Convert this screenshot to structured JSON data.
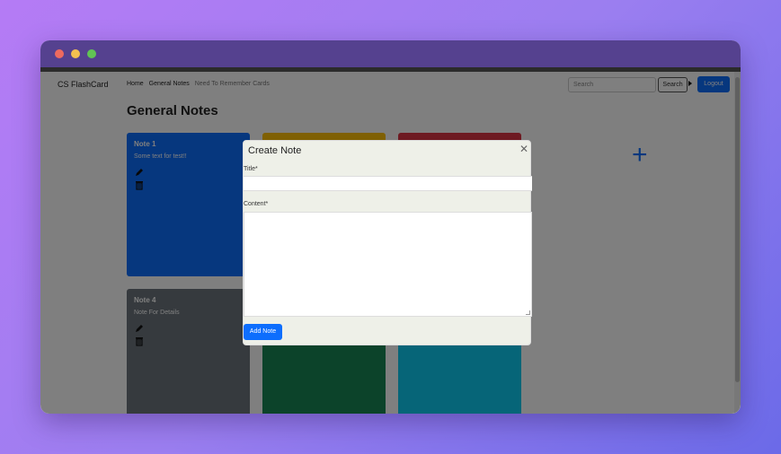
{
  "navbar": {
    "brand": "CS FlashCard",
    "links": [
      "Home",
      "General Notes",
      "Need To Remember Cards"
    ],
    "search_placeholder": "Search",
    "search_label": "Search",
    "logout_label": "Logout"
  },
  "main": {
    "heading": "General Notes",
    "add_symbol": "+",
    "cards": [
      {
        "title": "Note 1",
        "text": "Some text for test!!"
      },
      {
        "title": "",
        "text": ""
      },
      {
        "title": "",
        "text": ""
      },
      {
        "title": "Note 4",
        "text": "Note For Details"
      },
      {
        "title": "",
        "text": ""
      },
      {
        "title": "",
        "text": ""
      }
    ]
  },
  "modal": {
    "title": "Create Note",
    "close": "✕",
    "title_label": "Title*",
    "content_label": "Content*",
    "submit_label": "Add Note"
  },
  "colors": {
    "primary": "#0d6efd",
    "card_colors": [
      "#0d6efd",
      "#ffc107",
      "#dc3545",
      "#6c757d",
      "#198754",
      "#0dcaf0"
    ]
  },
  "icons": [
    "pencil-icon",
    "trash-icon",
    "close-icon",
    "plus-icon"
  ]
}
